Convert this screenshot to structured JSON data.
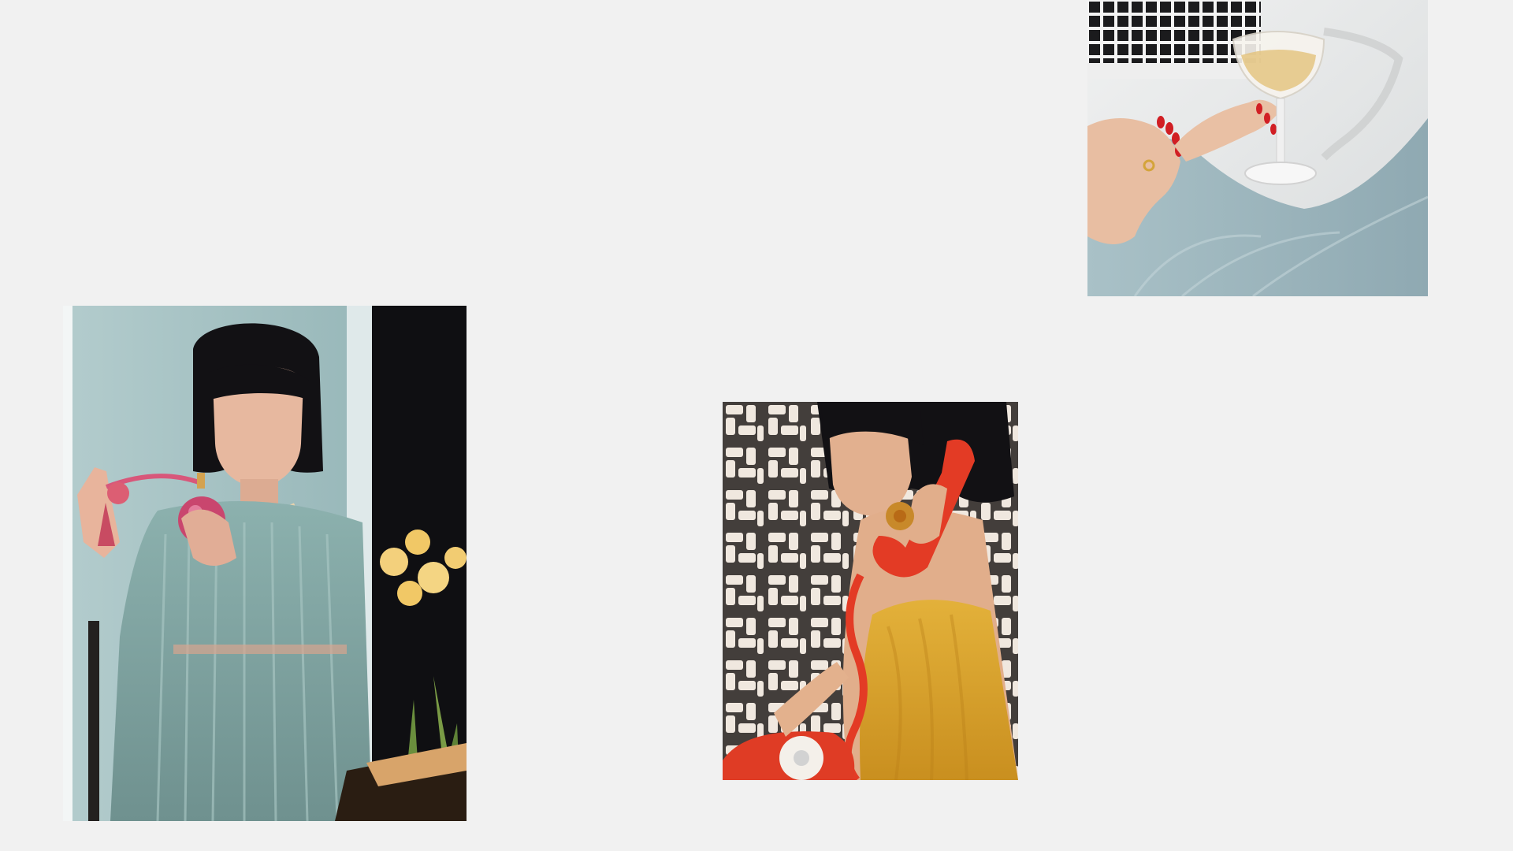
{
  "gallery": {
    "photos": [
      {
        "id": "perfume",
        "alt": "",
        "palette": {
          "wall": "#9eb7b8",
          "curtain": "#0d0d10",
          "dress": "#8fb0ad",
          "skin": "#e8b79f",
          "hair": "#141316",
          "accent": "#d8577a",
          "flowers": "#f2d27a"
        }
      },
      {
        "id": "phone",
        "alt": "",
        "palette": {
          "floor_light": "#efe7de",
          "floor_dark": "#2b2624",
          "dress": "#d9a42a",
          "skin": "#e4b28f",
          "hair": "#121114",
          "phone": "#e33b25"
        }
      },
      {
        "id": "champagne",
        "alt": "",
        "palette": {
          "tile_dark": "#1b1b1d",
          "tile_grout": "#f4f4f4",
          "tub": "#e5e7e7",
          "fabric": "#9db6bf",
          "skin": "#e7c0a5",
          "nails": "#d11f24",
          "glass": "#f7f4ee",
          "drink": "#e3c27a"
        }
      }
    ]
  }
}
